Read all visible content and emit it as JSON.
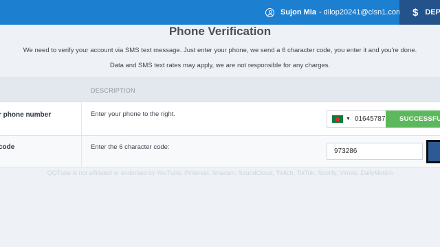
{
  "header": {
    "user_name": "Sujon Mia",
    "user_email": "- dilop20241@clsn1.com",
    "deposit_label": "DEPO"
  },
  "page": {
    "title": "Phone Verification",
    "intro_line1": "We need to verify your account via SMS text message. Just enter your phone, we send a 6 character code, you enter it and you're done.",
    "intro_line2": "Data and SMS text rates may apply, we are not responsible for any charges."
  },
  "table": {
    "description_header": "DESCRIPTION",
    "rows": [
      {
        "step": "r phone number",
        "description": "Enter your phone to the right."
      },
      {
        "step": "code",
        "description": "Enter the 6 character code:"
      }
    ]
  },
  "phone_input": {
    "country_flag": "bangladesh-flag",
    "value": "01645787"
  },
  "success_button": {
    "label": "SUCCESSFUL"
  },
  "code_input": {
    "value": "973286"
  },
  "footer": {
    "text": "QQTube is not affiliated or endorsed by YouTube, Pinterest, Shazam, SoundCloud, Twitch, TikTok, Spotify, Vimeo, DailyMotion"
  },
  "colors": {
    "header": "#1d7fd0",
    "deposit": "#23538a",
    "success": "#5cb85c",
    "verify_button": "#2c5a93"
  }
}
